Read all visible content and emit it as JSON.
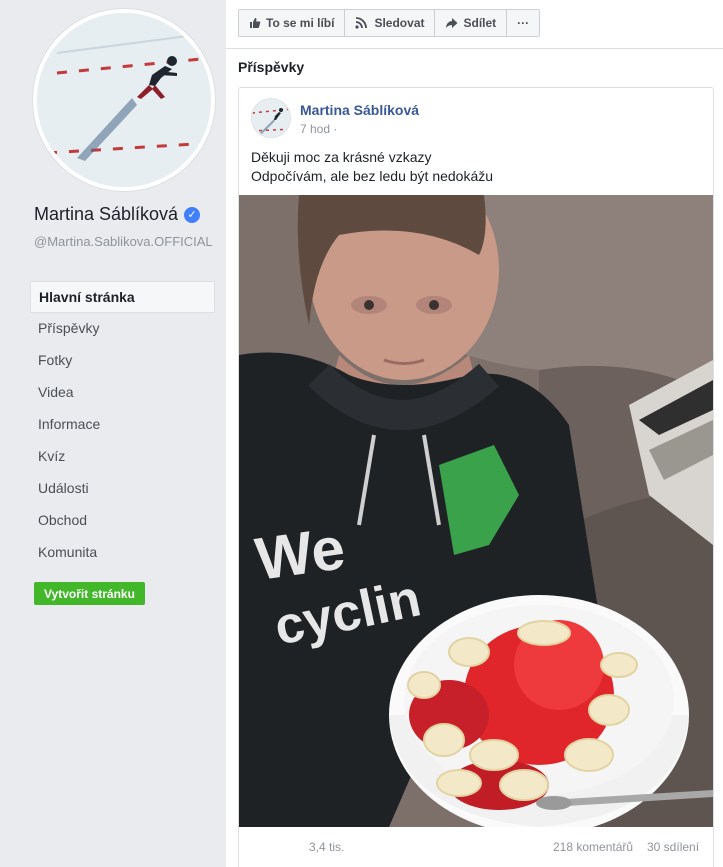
{
  "profile": {
    "name": "Martina Sáblíková",
    "handle": "@Martina.Sablikova.OFFICIAL",
    "verified_icon": "verified-badge-icon"
  },
  "nav": {
    "items": [
      {
        "label": "Hlavní stránka"
      },
      {
        "label": "Příspěvky"
      },
      {
        "label": "Fotky"
      },
      {
        "label": "Videa"
      },
      {
        "label": "Informace"
      },
      {
        "label": "Kvíz"
      },
      {
        "label": "Události"
      },
      {
        "label": "Obchod"
      },
      {
        "label": "Komunita"
      }
    ],
    "create_page": "Vytvořit stránku"
  },
  "actions": {
    "like": "To se mi líbí",
    "follow": "Sledovat",
    "share": "Sdílet",
    "more": "···"
  },
  "section_title": "Příspěvky",
  "post": {
    "author": "Martina Sáblíková",
    "time": "7 hod ·",
    "text_line1": "Děkuji moc za krásné vzkazy",
    "text_line2": "Odpočívám, ale bez ledu být nedokážu",
    "likes": "3,4 tis.",
    "comments": "218 komentářů",
    "shares": "30 sdílení"
  },
  "colors": {
    "link": "#385898",
    "create_button": "#42b72a",
    "verified": "#4080ff"
  }
}
